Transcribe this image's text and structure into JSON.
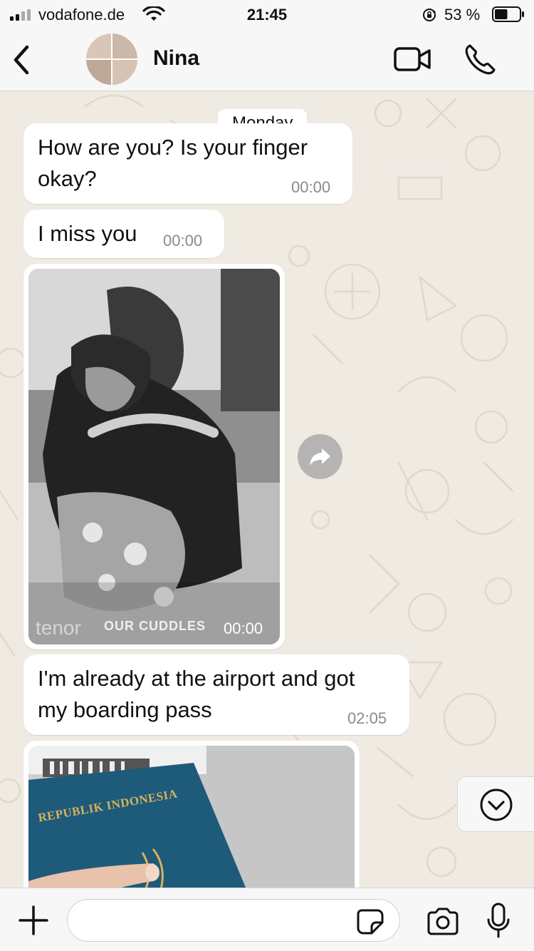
{
  "status_bar": {
    "carrier": "vodafone.de",
    "time": "21:45",
    "battery_percent": "53 %",
    "battery_level": 0.53,
    "icons": [
      "signal-icon",
      "wifi-icon",
      "rotation-lock-icon",
      "battery-icon"
    ]
  },
  "header": {
    "contact_name": "Nina",
    "icons": [
      "back-chevron-icon",
      "video-call-icon",
      "phone-call-icon"
    ]
  },
  "chat": {
    "day_separator": "Monday",
    "messages": [
      {
        "type": "text",
        "text_line1": "How are you? Is your finger",
        "text_line2": "okay?",
        "time": "00:00"
      },
      {
        "type": "text",
        "text": "I miss you",
        "time": "00:00"
      },
      {
        "type": "gif",
        "watermark": "tenor",
        "caption": "OUR CUDDLES",
        "time": "00:00"
      },
      {
        "type": "text",
        "text_line1": "I'm already at the airport and got",
        "text_line2": "my boarding pass",
        "time": "02:05"
      },
      {
        "type": "image",
        "visible_text": "REPUBLIK INDONESIA"
      }
    ]
  },
  "composer": {
    "placeholder": "",
    "icons": [
      "plus-icon",
      "sticker-icon",
      "camera-icon",
      "microphone-icon"
    ]
  },
  "colors": {
    "chat_background": "#efeae2",
    "bubble": "#ffffff",
    "bar_background": "#f7f7f7",
    "timestamp": "#8a8a8a",
    "passport_blue": "#1e5a7a",
    "passport_gold": "#d8b25a"
  }
}
